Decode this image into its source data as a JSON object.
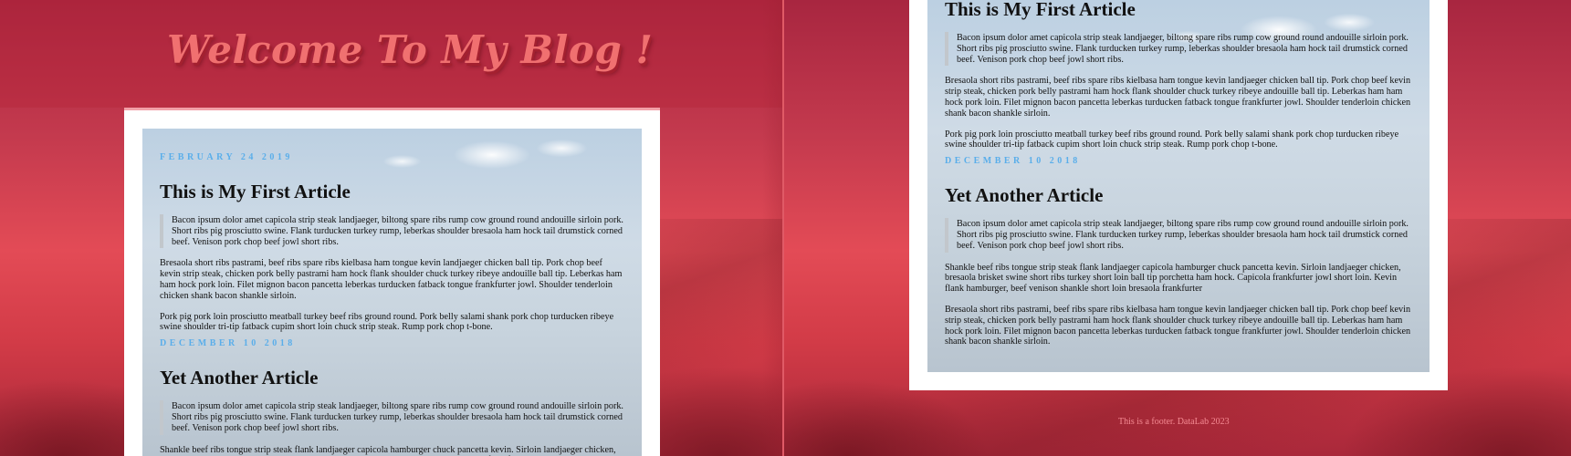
{
  "blog_title": "Welcome To My Blog !",
  "posts": [
    {
      "date": "FEBRUARY 24 2019",
      "title": "This is My First Article",
      "quote": "Bacon ipsum dolor amet capicola strip steak landjaeger, biltong spare ribs rump cow ground round andouille sirloin pork. Short ribs pig prosciutto swine. Flank turducken turkey rump, leberkas shoulder bresaola ham hock tail drumstick corned beef. Venison pork chop beef jowl short ribs.",
      "paragraphs": [
        "Bresaola short ribs pastrami, beef ribs spare ribs kielbasa ham tongue kevin landjaeger chicken ball tip. Pork chop beef kevin strip steak, chicken pork belly pastrami ham hock flank shoulder chuck turkey ribeye andouille ball tip. Leberkas ham ham hock pork loin. Filet mignon bacon pancetta leberkas turducken fatback tongue frankfurter jowl. Shoulder tenderloin chicken shank bacon shankle sirloin.",
        "Pork pig pork loin prosciutto meatball turkey beef ribs ground round. Pork belly salami shank pork chop turducken ribeye swine shoulder tri-tip fatback cupim short loin chuck strip steak. Rump pork chop t-bone."
      ]
    },
    {
      "date": "DECEMBER 10 2018",
      "title": "Yet Another Article",
      "quote": "Bacon ipsum dolor amet capicola strip steak landjaeger, biltong spare ribs rump cow ground round andouille sirloin pork. Short ribs pig prosciutto swine. Flank turducken turkey rump, leberkas shoulder bresaola ham hock tail drumstick corned beef. Venison pork chop beef jowl short ribs.",
      "paragraphs": [
        "Shankle beef ribs tongue strip steak flank landjaeger capicola hamburger chuck pancetta kevin. Sirloin landjaeger chicken, bresaola brisket swine short ribs turkey short loin ball tip porchetta ham hock. Capicola frankfurter jowl short loin. Kevin flank hamburger, beef venison shankle short loin bresaola frankfurter",
        "Bresaola short ribs pastrami, beef ribs spare ribs kielbasa ham tongue kevin landjaeger chicken ball tip. Pork chop beef kevin strip steak, chicken pork belly pastrami ham hock flank shoulder chuck turkey ribeye andouille ball tip. Leberkas ham ham hock pork loin. Filet mignon bacon pancetta leberkas turducken fatback tongue frankfurter jowl. Shoulder tenderloin chicken shank bacon shankle sirloin."
      ]
    }
  ],
  "footer": "This is a footer. DataLab 2023",
  "colors": {
    "background_red": "#b3273a",
    "title_pink": "#f07070",
    "date_blue": "#5aaeea",
    "footer_pink": "#f48a92",
    "card_white": "#ffffff"
  }
}
